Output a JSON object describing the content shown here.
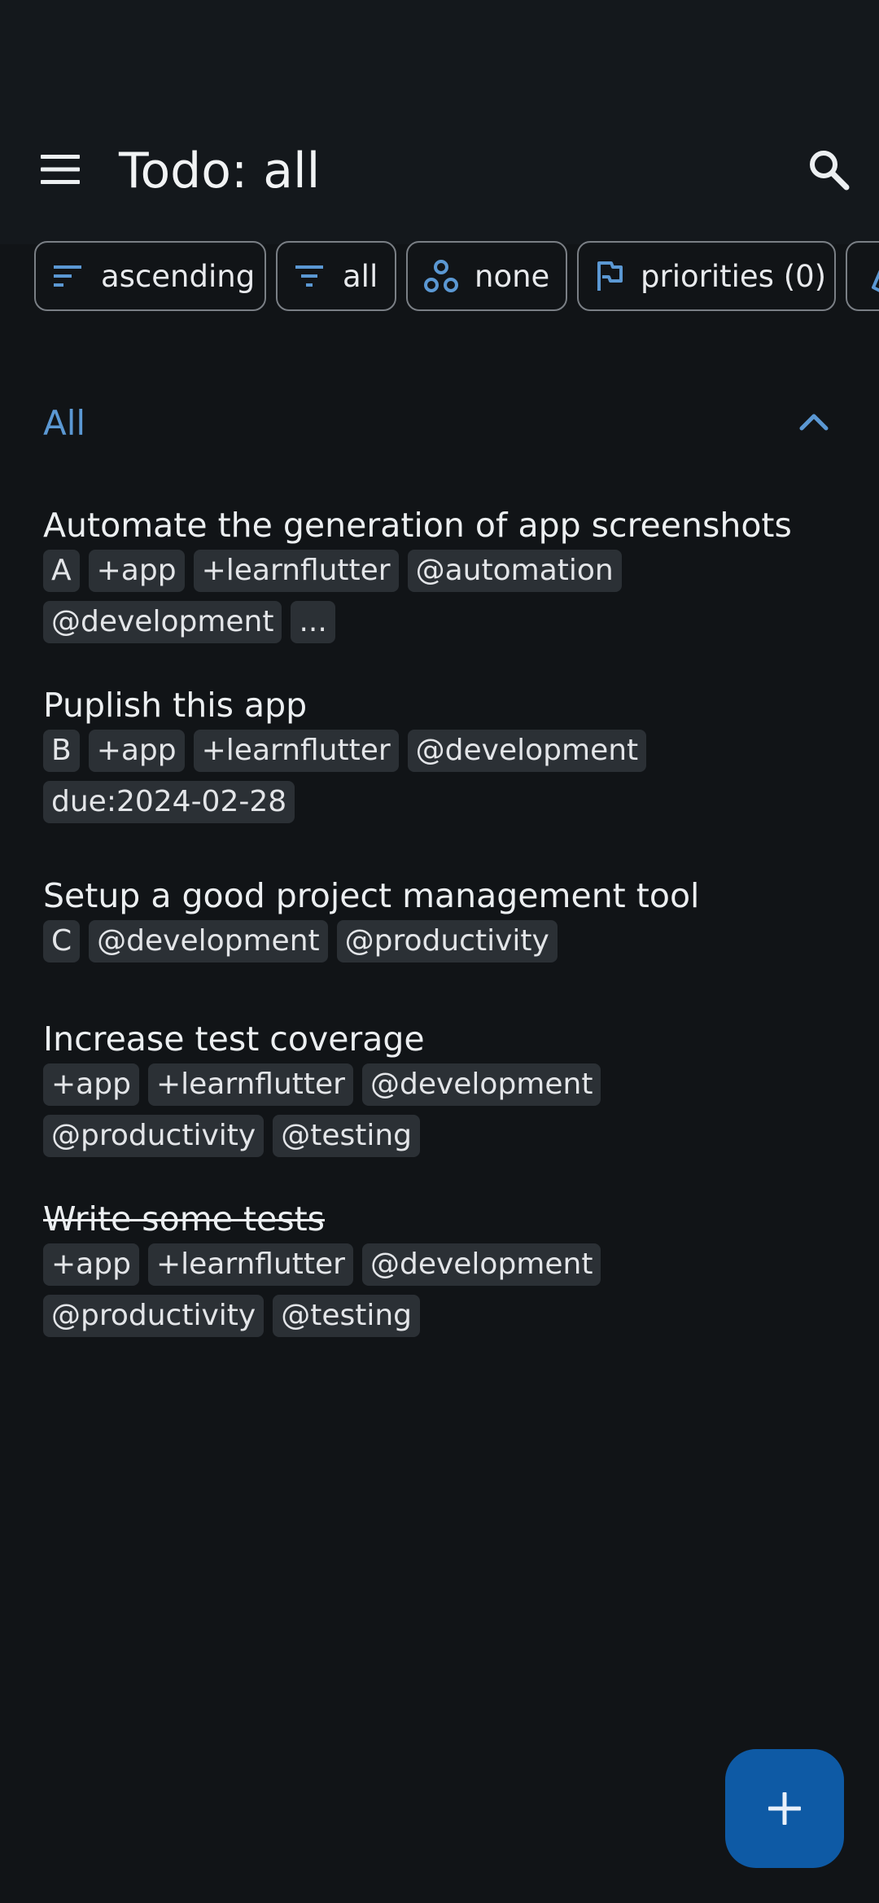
{
  "appbar": {
    "title": "Todo: all"
  },
  "filter_chips": [
    {
      "label": "ascending",
      "icon": "sort-icon"
    },
    {
      "label": "all",
      "icon": "filter-icon"
    },
    {
      "label": "none",
      "icon": "group-icon"
    },
    {
      "label": "priorities (0)",
      "icon": "flag-icon"
    }
  ],
  "section": {
    "title": "All"
  },
  "todos": [
    {
      "title": "Automate the generation of app screenshots",
      "completed": false,
      "tags": [
        "A",
        "+app",
        "+learnflutter",
        "@automation",
        "@development",
        "..."
      ]
    },
    {
      "title": "Puplish this app",
      "completed": false,
      "tags": [
        "B",
        "+app",
        "+learnflutter",
        "@development",
        "due:2024-02-28"
      ]
    },
    {
      "title": "Setup a good project management tool",
      "completed": false,
      "tags": [
        "C",
        "@development",
        "@productivity"
      ]
    },
    {
      "title": "Increase test coverage",
      "completed": false,
      "tags": [
        "+app",
        "+learnflutter",
        "@development",
        "@productivity",
        "@testing"
      ]
    },
    {
      "title": "Write some tests",
      "completed": true,
      "tags": [
        "+app",
        "+learnflutter",
        "@development",
        "@productivity",
        "@testing"
      ]
    }
  ],
  "colors": {
    "background": "#111417",
    "accent": "#5b98d3",
    "fab": "#0e5aa5",
    "tag_background": "#2b3035"
  }
}
